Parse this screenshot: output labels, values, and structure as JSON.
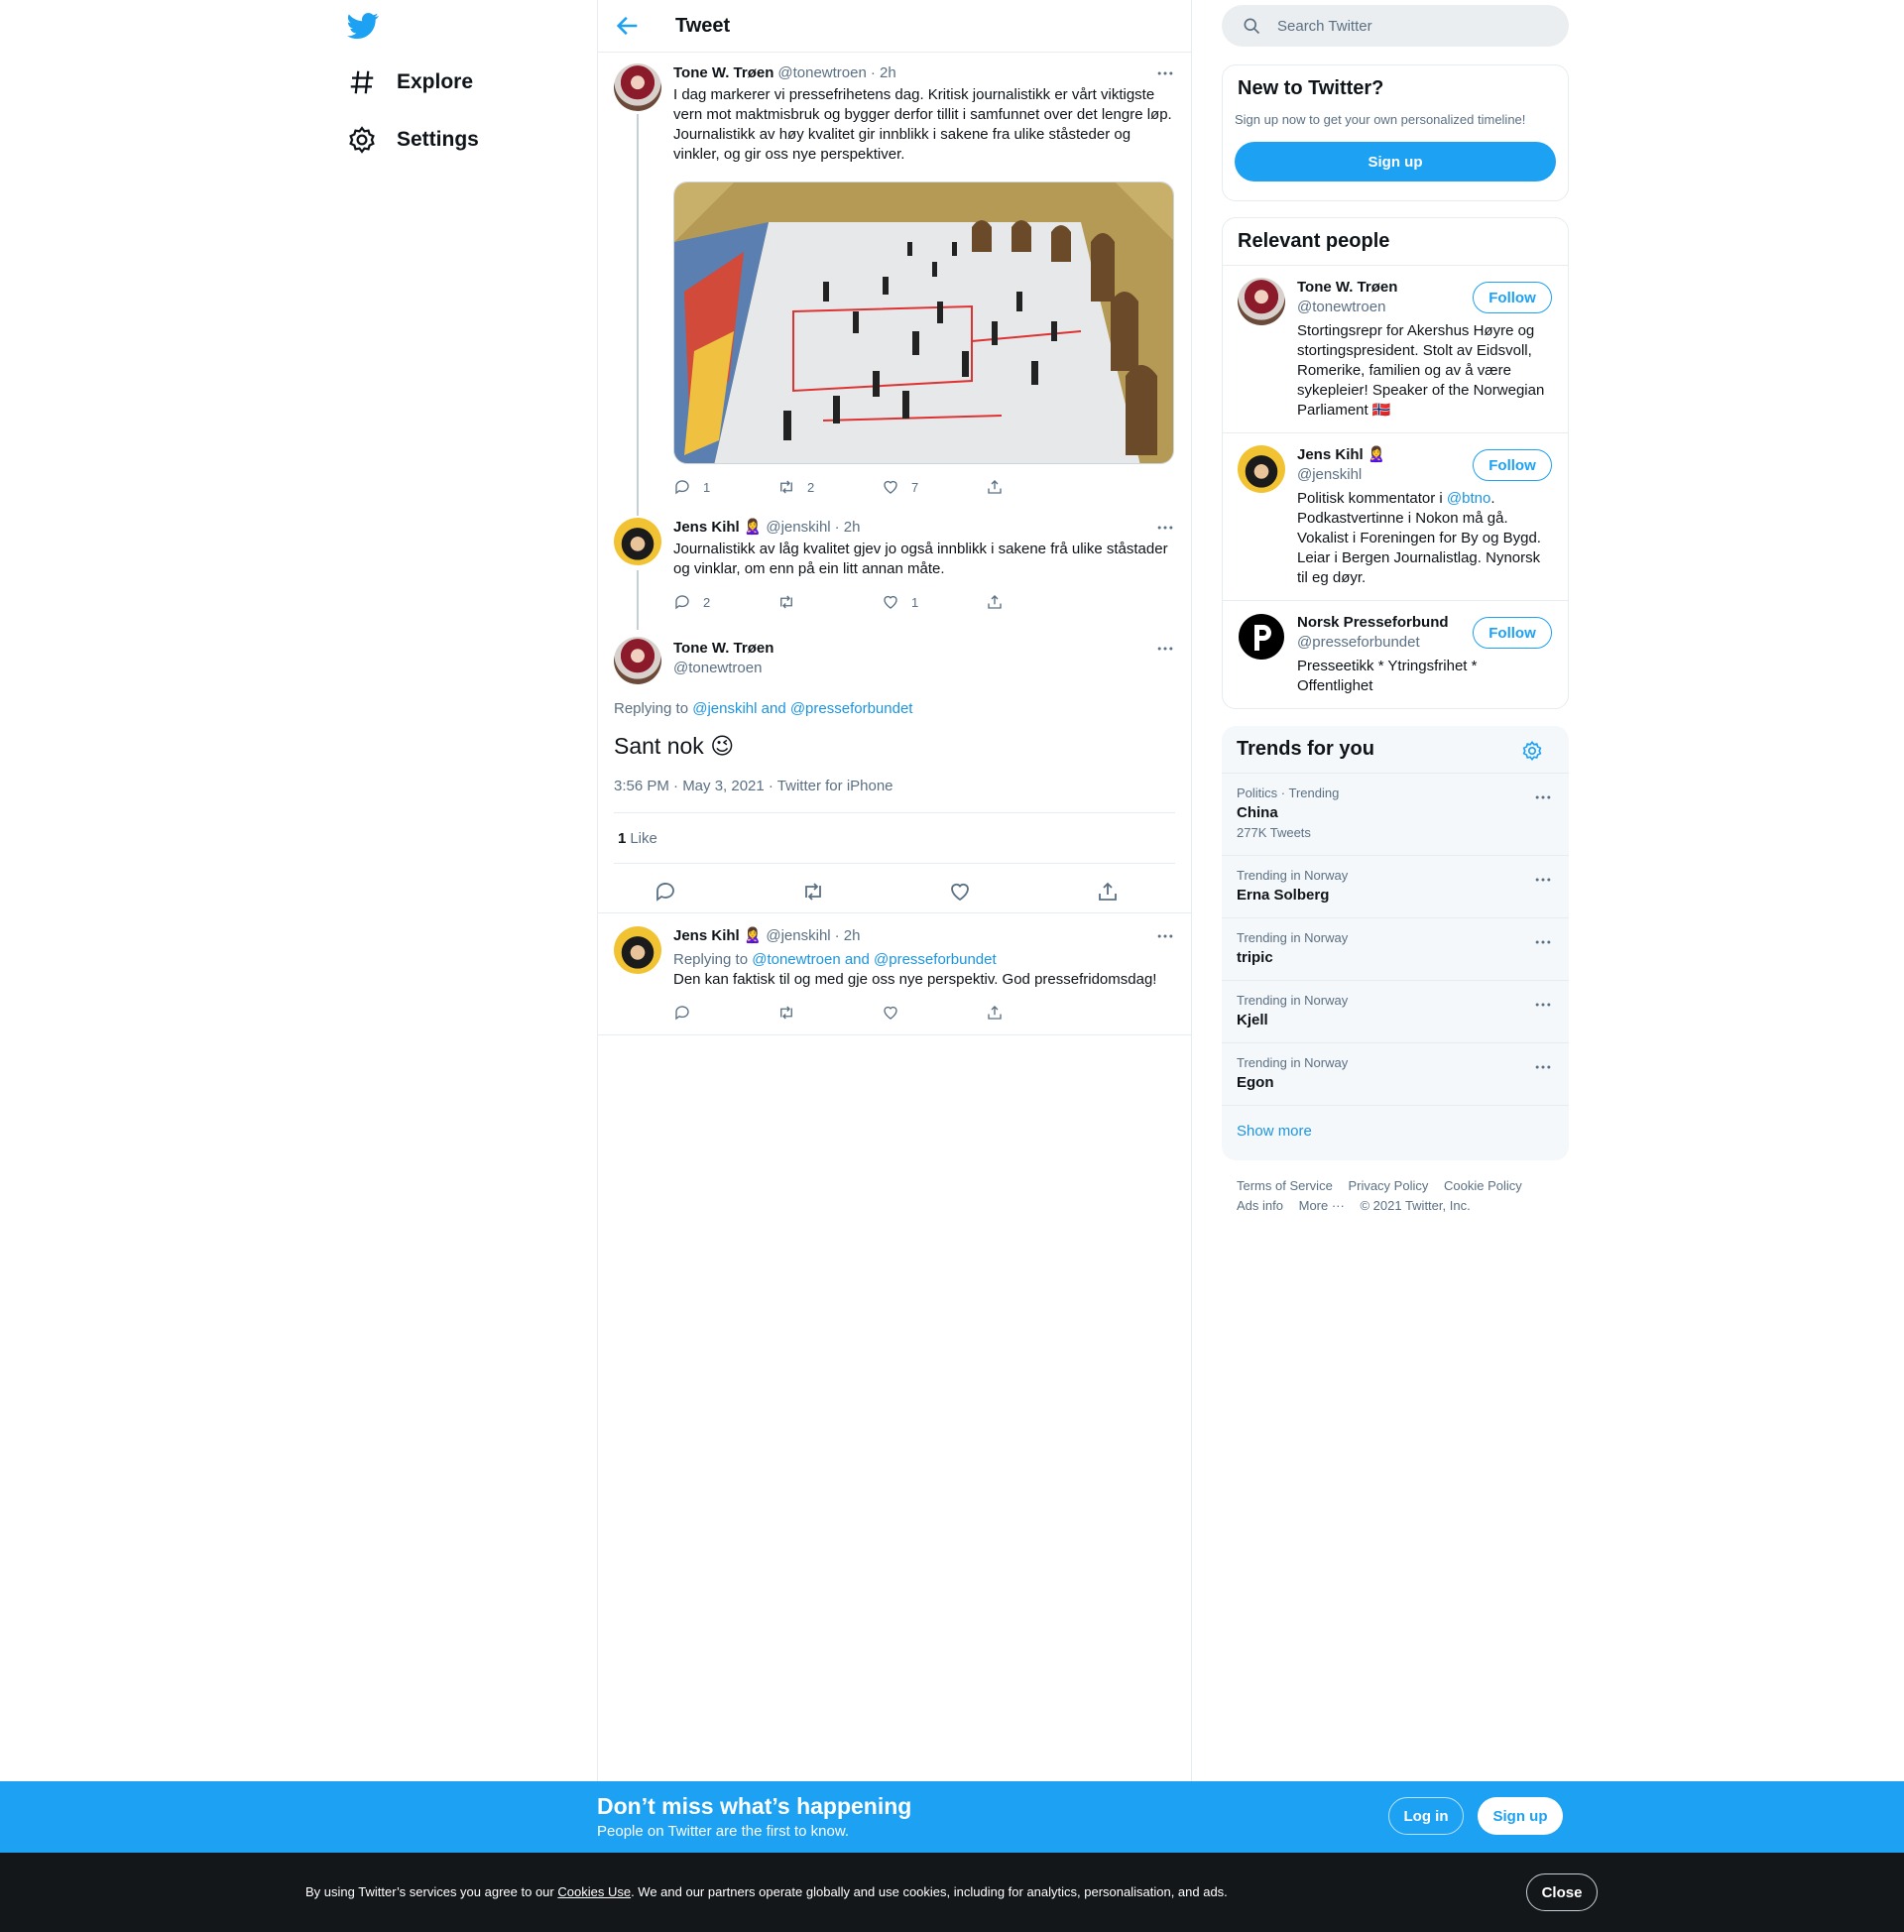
{
  "nav": {
    "explore": "Explore",
    "settings": "Settings"
  },
  "header": {
    "title": "Tweet"
  },
  "tweet1": {
    "name": "Tone W. Trøen",
    "handle": "@tonewtroen",
    "time": "· 2h",
    "text": "I dag markerer vi pressefrihetens dag. Kritisk journalistikk er vårt viktigste vern mot maktmisbruk og bygger derfor tillit i samfunnet over det lengre løp. Journalistikk av høy kvalitet gir innblikk i sakene fra ulike ståsteder og vinkler, og gir oss nye perspektiver.",
    "replies": "1",
    "retweets": "2",
    "likes": "7"
  },
  "tweet2": {
    "name": "Jens Kihl",
    "emoji": "🙎‍♀️",
    "handle": "@jenskihl",
    "time": "· 2h",
    "text": "Journalistikk av låg kvalitet gjev jo også innblikk i sakene frå ulike ståstader og vinklar, om enn på ein litt annan måte.",
    "replies": "2",
    "likes": "1"
  },
  "main": {
    "name": "Tone W. Trøen",
    "handle": "@tonewtroen",
    "replying_prefix": "Replying to",
    "replying_to": "@jenskihl and @presseforbundet",
    "text": "Sant nok",
    "emoji": "😉",
    "timestamp": "3:56 PM · May 3, 2021 · Twitter for iPhone",
    "likes_count": "1",
    "likes_label": "Like"
  },
  "reply": {
    "name": "Jens Kihl",
    "emoji": "🙎‍♀️",
    "handle": "@jenskihl",
    "time": "· 2h",
    "replying_prefix": "Replying to",
    "replying_to": "@tonewtroen and @presseforbundet",
    "text": "Den kan faktisk til og med gje oss nye perspektiv. God pressefridomsdag!"
  },
  "search": {
    "placeholder": "Search Twitter"
  },
  "new_to_twitter": {
    "title": "New to Twitter?",
    "subtitle": "Sign up now to get your own personalized timeline!",
    "button": "Sign up"
  },
  "relevant": {
    "title": "Relevant people",
    "follow": "Follow",
    "people": [
      {
        "name": "Tone W. Trøen",
        "handle": "@tonewtroen",
        "bio": "Stortingsrepr for Akershus Høyre og stortingspresident. Stolt av Eidsvoll, Romerike, familien og av å være sykepleier! Speaker of the Norwegian Parliament 🇳🇴"
      },
      {
        "name": "Jens Kihl",
        "emoji": "🙎‍♀️",
        "handle": "@jenskihl",
        "bio_pre": "Politisk kommentator i",
        "bio_link": "@btno",
        "bio_post": ". Podkastvertinne i Nokon må gå. Vokalist i Foreningen for By og Bygd. Leiar i Bergen Journalistlag. Nynorsk til eg døyr."
      },
      {
        "name": "Norsk Presseforbund",
        "handle": "@presseforbundet",
        "bio": "Presseetikk * Ytringsfrihet * Offentlighet"
      }
    ]
  },
  "trends": {
    "title": "Trends for you",
    "items": [
      {
        "meta": "Politics · Trending",
        "name": "China",
        "count": "277K Tweets"
      },
      {
        "meta": "Trending in Norway",
        "name": "Erna Solberg"
      },
      {
        "meta": "Trending in Norway",
        "name": "tripic"
      },
      {
        "meta": "Trending in Norway",
        "name": "Kjell"
      },
      {
        "meta": "Trending in Norway",
        "name": "Egon"
      }
    ],
    "show_more": "Show more"
  },
  "footer": {
    "terms": "Terms of Service",
    "privacy": "Privacy Policy",
    "cookie": "Cookie Policy",
    "ads": "Ads info",
    "more": "More ···",
    "copyright": "© 2021 Twitter, Inc."
  },
  "banner": {
    "title": "Don’t miss what’s happening",
    "subtitle": "People on Twitter are the first to know.",
    "login": "Log in",
    "signup": "Sign up"
  },
  "cookie": {
    "pre": "By using Twitter’s services you agree to our",
    "link": "Cookies Use",
    "post": ". We and our partners operate globally and use cookies, including for analytics, personalisation, and ads.",
    "close": "Close"
  }
}
